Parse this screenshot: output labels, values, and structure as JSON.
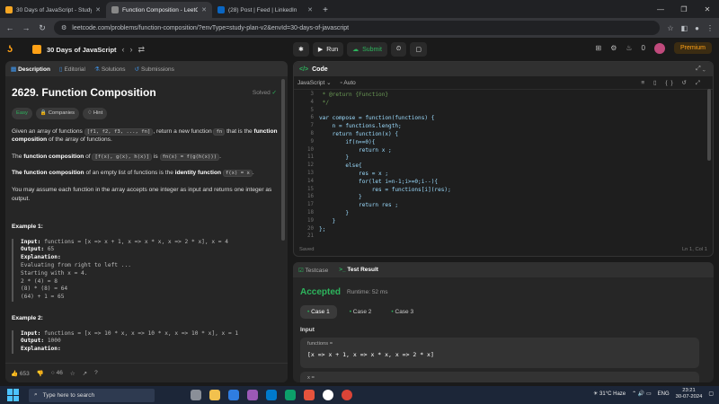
{
  "browser": {
    "tabs": [
      {
        "title": "30 Days of JavaScript - Study Pl",
        "active": false,
        "icon": "leetcode-favicon"
      },
      {
        "title": "Function Composition - LeetCod",
        "active": true,
        "icon": "leetcode-favicon"
      },
      {
        "title": "(28) Post | Feed | LinkedIn",
        "active": false,
        "icon": "linkedin-favicon"
      }
    ],
    "url": "leetcode.com/problems/function-composition/?envType=study-plan-v2&envId=30-days-of-javascript"
  },
  "header": {
    "study_plan": "30 Days of JavaScript",
    "run_label": "Run",
    "submit_label": "Submit",
    "coins": "0",
    "premium_label": "Premium"
  },
  "left_tabs": [
    "Description",
    "Editorial",
    "Solutions",
    "Submissions"
  ],
  "problem": {
    "title": "2629. Function Composition",
    "status": "Solved",
    "difficulty": "Easy",
    "companies_label": "Companies",
    "hint_label": "Hint",
    "p1_a": "Given an array of functions",
    "p1_code1": "[f1, f2, f3, ..., fn]",
    "p1_b": ", return a new function",
    "p1_code2": "fn",
    "p1_c": "that is the",
    "p1_bold": "function composition",
    "p1_d": "of the array of functions.",
    "p2_a": "The",
    "p2_bold": "function composition",
    "p2_b": "of",
    "p2_code1": "[f(x), g(x), h(x)]",
    "p2_c": "is",
    "p2_code2": "fn(x) = f(g(h(x)))",
    "p3_bold1": "The function composition",
    "p3_a": "of an empty list of functions is the",
    "p3_bold2": "identity function",
    "p3_code": "f(x) = x",
    "p4": "You may assume each function in the array accepts one integer as input and returns one integer as output.",
    "example1_heading": "Example 1:",
    "example1_lines": [
      {
        "label": "Input:",
        "text": "functions = [x => x + 1, x => x * x, x => 2 * x], x = 4"
      },
      {
        "label": "Output:",
        "text": "65"
      },
      {
        "label": "Explanation:",
        "text": ""
      },
      {
        "label": "",
        "text": "Evaluating from right to left ..."
      },
      {
        "label": "",
        "text": "Starting with x = 4."
      },
      {
        "label": "",
        "text": "2 * (4) = 8"
      },
      {
        "label": "",
        "text": "(8) * (8) = 64"
      },
      {
        "label": "",
        "text": "(64) + 1 = 65"
      }
    ],
    "example2_heading": "Example 2:",
    "example2_lines": [
      {
        "label": "Input:",
        "text": "functions = [x => 10 * x, x => 10 * x, x => 10 * x], x = 1"
      },
      {
        "label": "Output:",
        "text": "1000"
      },
      {
        "label": "Explanation:",
        "text": ""
      }
    ],
    "likes": "653",
    "comments": "46"
  },
  "code_panel": {
    "title": "Code",
    "language": "JavaScript",
    "mode": "Auto",
    "status_left": "Saved",
    "status_right": "Ln 1, Col 1",
    "lines": [
      {
        "n": "3",
        "code": " * @return {Function}"
      },
      {
        "n": "4",
        "code": " */"
      },
      {
        "n": "5",
        "code": ""
      },
      {
        "n": "6",
        "code": "var compose = function(functions) {"
      },
      {
        "n": "7",
        "code": "    n = functions.length;"
      },
      {
        "n": "8",
        "code": "    return function(x) {"
      },
      {
        "n": "9",
        "code": "        if(n==0){"
      },
      {
        "n": "10",
        "code": "            return x ;"
      },
      {
        "n": "11",
        "code": "        }"
      },
      {
        "n": "12",
        "code": "        else{"
      },
      {
        "n": "13",
        "code": "            res = x ;"
      },
      {
        "n": "14",
        "code": "            for(let i=n-1;i>=0;i--){"
      },
      {
        "n": "15",
        "code": "                res = functions[i](res);"
      },
      {
        "n": "16",
        "code": "            }"
      },
      {
        "n": "17",
        "code": "            return res ;"
      },
      {
        "n": "18",
        "code": "        }"
      },
      {
        "n": "19",
        "code": "    }"
      },
      {
        "n": "20",
        "code": "};"
      },
      {
        "n": "21",
        "code": ""
      }
    ]
  },
  "test_panel": {
    "testcase_tab": "Testcase",
    "result_tab": "Test Result",
    "verdict": "Accepted",
    "runtime": "Runtime: 52 ms",
    "cases": [
      "Case 1",
      "Case 2",
      "Case 3"
    ],
    "input_label": "Input",
    "input_key": "functions =",
    "input_value": "[x => x + 1, x => x * x, x => 2 * x]",
    "input2_key": "x ="
  },
  "taskbar": {
    "search_placeholder": "Type here to search",
    "weather": "31°C  Haze",
    "lang": "ENG",
    "time": "23:21",
    "date": "30-07-2024"
  },
  "colors": {
    "accent": "#ffa116",
    "success": "#2db55d",
    "link": "#3e8ede"
  }
}
